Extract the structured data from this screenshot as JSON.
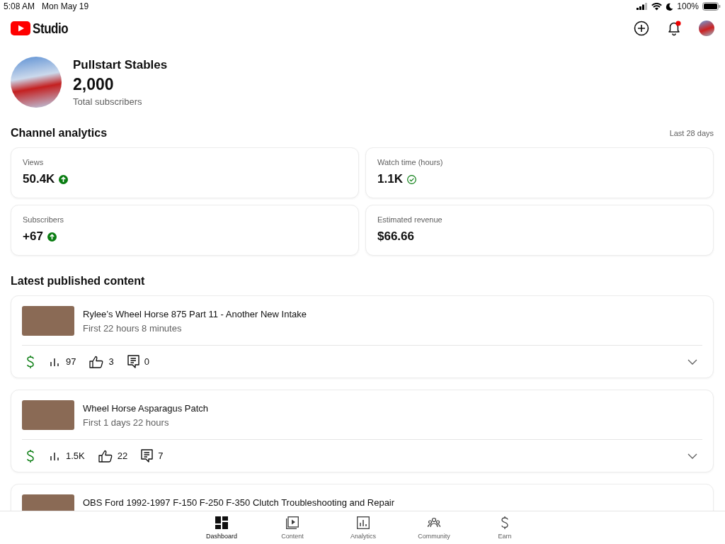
{
  "status_bar": {
    "time": "5:08 AM",
    "date": "Mon May 19",
    "battery": "100%"
  },
  "header": {
    "logo_text": "Studio",
    "notification_unread": true
  },
  "channel": {
    "name": "Pullstart Stables",
    "subscribers": "2,000",
    "subscribers_label": "Total subscribers"
  },
  "analytics": {
    "title": "Channel analytics",
    "period": "Last 28 days",
    "metrics": [
      {
        "label": "Views",
        "value": "50.4K",
        "kind": "up"
      },
      {
        "label": "Watch time (hours)",
        "value": "1.1K",
        "kind": "check"
      },
      {
        "label": "Subscribers",
        "value": "+67",
        "kind": "up"
      },
      {
        "label": "Estimated revenue",
        "value": "$66.66",
        "kind": "plain"
      }
    ]
  },
  "latest": {
    "title": "Latest published content",
    "videos": [
      {
        "title": "Rylee’s Wheel Horse 875 Part 11 - Another New Intake",
        "period": "First 22 hours 8 minutes",
        "views": "97",
        "likes": "3",
        "comments": "0",
        "monetized": true
      },
      {
        "title": "Wheel Horse Asparagus Patch",
        "period": "First 1 days 22 hours",
        "views": "1.5K",
        "likes": "22",
        "comments": "7",
        "monetized": true
      },
      {
        "title": "OBS Ford 1992-1997 F-150 F-250 F-350 Clutch Troubleshooting and Repair"
      }
    ]
  },
  "nav": [
    {
      "label": "Dashboard",
      "kind": "dashboard",
      "selected": true
    },
    {
      "label": "Content",
      "kind": "content",
      "selected": false
    },
    {
      "label": "Analytics",
      "kind": "analytics",
      "selected": false
    },
    {
      "label": "Community",
      "kind": "community",
      "selected": false
    },
    {
      "label": "Earn",
      "kind": "earn",
      "selected": false
    }
  ]
}
